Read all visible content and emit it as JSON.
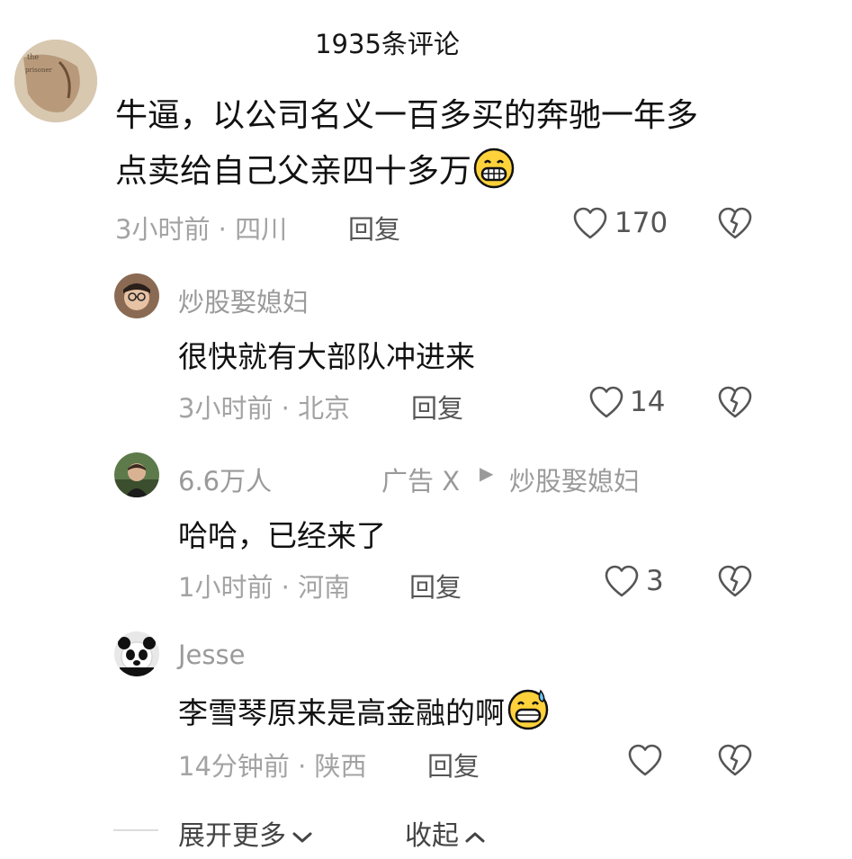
{
  "header": {
    "title": "1935条评论"
  },
  "comments": [
    {
      "text_line1": "牛逼，以公司名义一百多买的奔驰一年多",
      "text_line2": "点卖给自己父亲四十多万",
      "emoji": "grinning-face-emoji",
      "meta": "3小时前 · 四川",
      "reply_label": "回复",
      "likes": "170"
    }
  ],
  "replies": [
    {
      "username": "炒股娶媳妇",
      "text": "很快就有大部队冲进来",
      "meta": "3小时前 · 北京",
      "reply_label": "回复",
      "likes": "14"
    },
    {
      "username": "6.6万人",
      "ad_label": "广告 X",
      "reply_to_arrow": "▶",
      "reply_to": "炒股娶媳妇",
      "text": "哈哈，已经来了",
      "meta": "1小时前 · 河南",
      "reply_label": "回复",
      "likes": "3"
    },
    {
      "username": "Jesse",
      "text": "李雪琴原来是高金融的啊",
      "emoji": "grinning-sweat-emoji",
      "meta": "14分钟前 · 陕西",
      "reply_label": "回复",
      "likes": ""
    }
  ],
  "footer": {
    "expand_label": "展开更多",
    "collapse_label": "收起"
  },
  "colors": {
    "icon_stroke": "#555555",
    "meta_gray": "#a3a3a3"
  }
}
